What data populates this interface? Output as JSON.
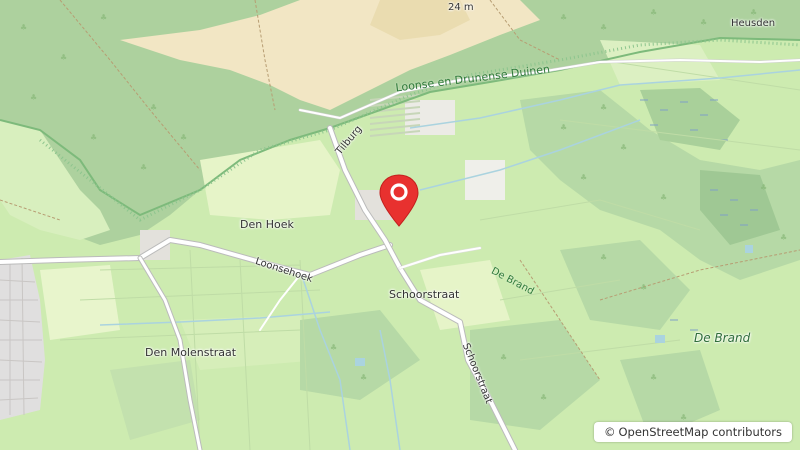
{
  "map": {
    "labels": {
      "loonse": "Loonse en Drunense Duinen",
      "heusden": "Heusden",
      "elevation": "24 m",
      "tilburg": "Tilburg",
      "den_hoek": "Den Hoek",
      "loonsehoek": "Loonsehoek",
      "schoorstraat": "Schoorstraat",
      "schoorstraat_road": "Schoorstraat",
      "de_brand_road": "De Brand",
      "de_brand_place": "De Brand",
      "den_molenstraat": "Den Molenstraat"
    },
    "marker": {
      "icon": "map-pin-icon",
      "color": "#e8312f"
    },
    "attribution": {
      "symbol": "©",
      "text": "OpenStreetMap contributors"
    },
    "colors": {
      "farmland": "#cdebb0",
      "forest": "#add19e",
      "sand": "#f5e9c6",
      "residential": "#e0dfdf",
      "water": "#aad3df",
      "road": "#ffffff"
    }
  }
}
